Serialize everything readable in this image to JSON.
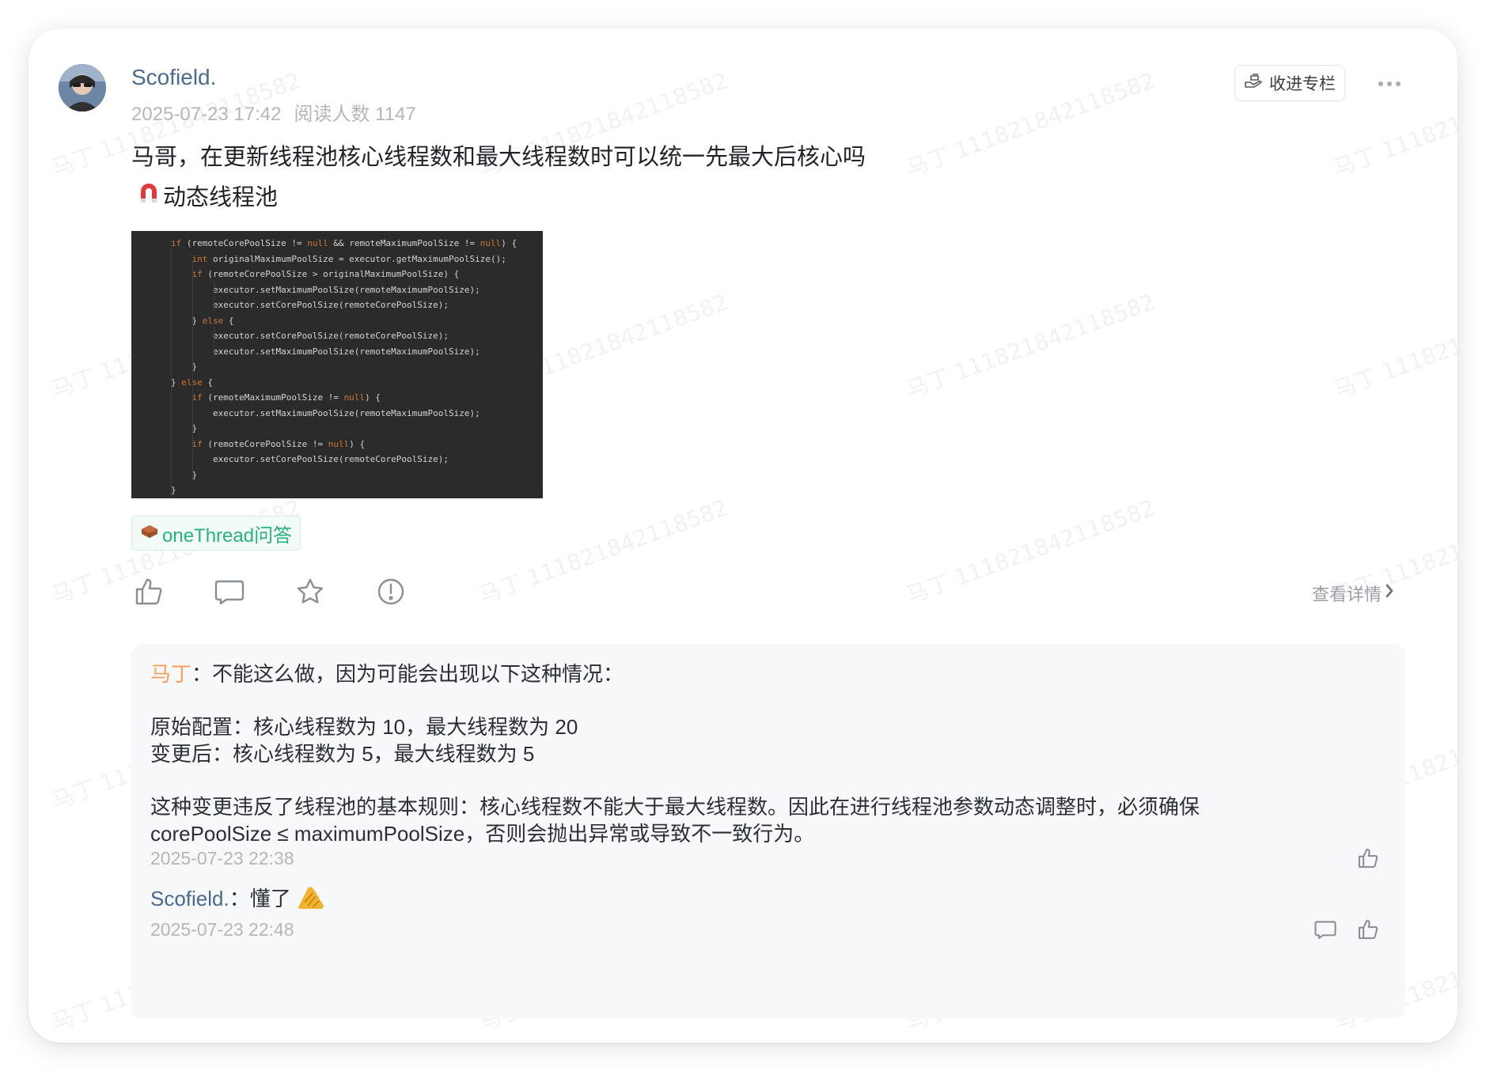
{
  "post": {
    "author": "Scofield.",
    "date": "2025-07-23 17:42",
    "views": "阅读人数 1147",
    "collect_label": "收进专栏",
    "text": "马哥，在更新线程池核心线程数和最大线程数时可以统一先最大后核心吗",
    "topic_label": "动态线程池",
    "tag_label": "oneThread问答",
    "detail_label": "查看详情",
    "watermark_text": "马丁 1118218421185​82",
    "code_lines": [
      "if (remoteCorePoolSize != null && remoteMaximumPoolSize != null) {",
      "    int originalMaximumPoolSize = executor.getMaximumPoolSize();",
      "    if (remoteCorePoolSize > originalMaximumPoolSize) {",
      "        executor.setMaximumPoolSize(remoteMaximumPoolSize);",
      "        executor.setCorePoolSize(remoteCorePoolSize);",
      "    } else {",
      "        executor.setCorePoolSize(remoteCorePoolSize);",
      "        executor.setMaximumPoolSize(remoteMaximumPoolSize);",
      "    }",
      "} else {",
      "    if (remoteMaximumPoolSize != null) {",
      "        executor.setMaximumPoolSize(remoteMaximumPoolSize);",
      "    }",
      "    if (remoteCorePoolSize != null) {",
      "        executor.setCorePoolSize(remoteCorePoolSize);",
      "    }",
      "}"
    ]
  },
  "replies": [
    {
      "name": "马丁",
      "sep": "：",
      "line1": "不能这么做，因为可能会出现以下这种情况：",
      "line2": "原始配置：核心线程数为 10，最大线程数为 20",
      "line3": "变更后：核心线程数为 5，最大线程数为 5",
      "line4": "这种变更违反了线程池的基本规则：核心线程数不能大于最大线程数。因此在进行线程池参数动态调整时，必须确保",
      "line5": "corePoolSize ≤ maximumPoolSize，否则会抛出异常或导致不一致行为。",
      "time": "2025-07-23 22:38"
    },
    {
      "name": "Scofield.",
      "sep": "：",
      "text": "懂了",
      "time": "2025-07-23 22:48"
    }
  ],
  "colors": {
    "accent_link": "#4a6a8e",
    "reply_name": "#f5a05a",
    "tag_green": "#2ab27b"
  },
  "icons": [
    "more-icon",
    "collect-icon",
    "like-icon",
    "comment-icon",
    "star-icon",
    "report-icon",
    "chevron-right-icon",
    "magnet-icon",
    "brick-icon",
    "fist-icon"
  ]
}
